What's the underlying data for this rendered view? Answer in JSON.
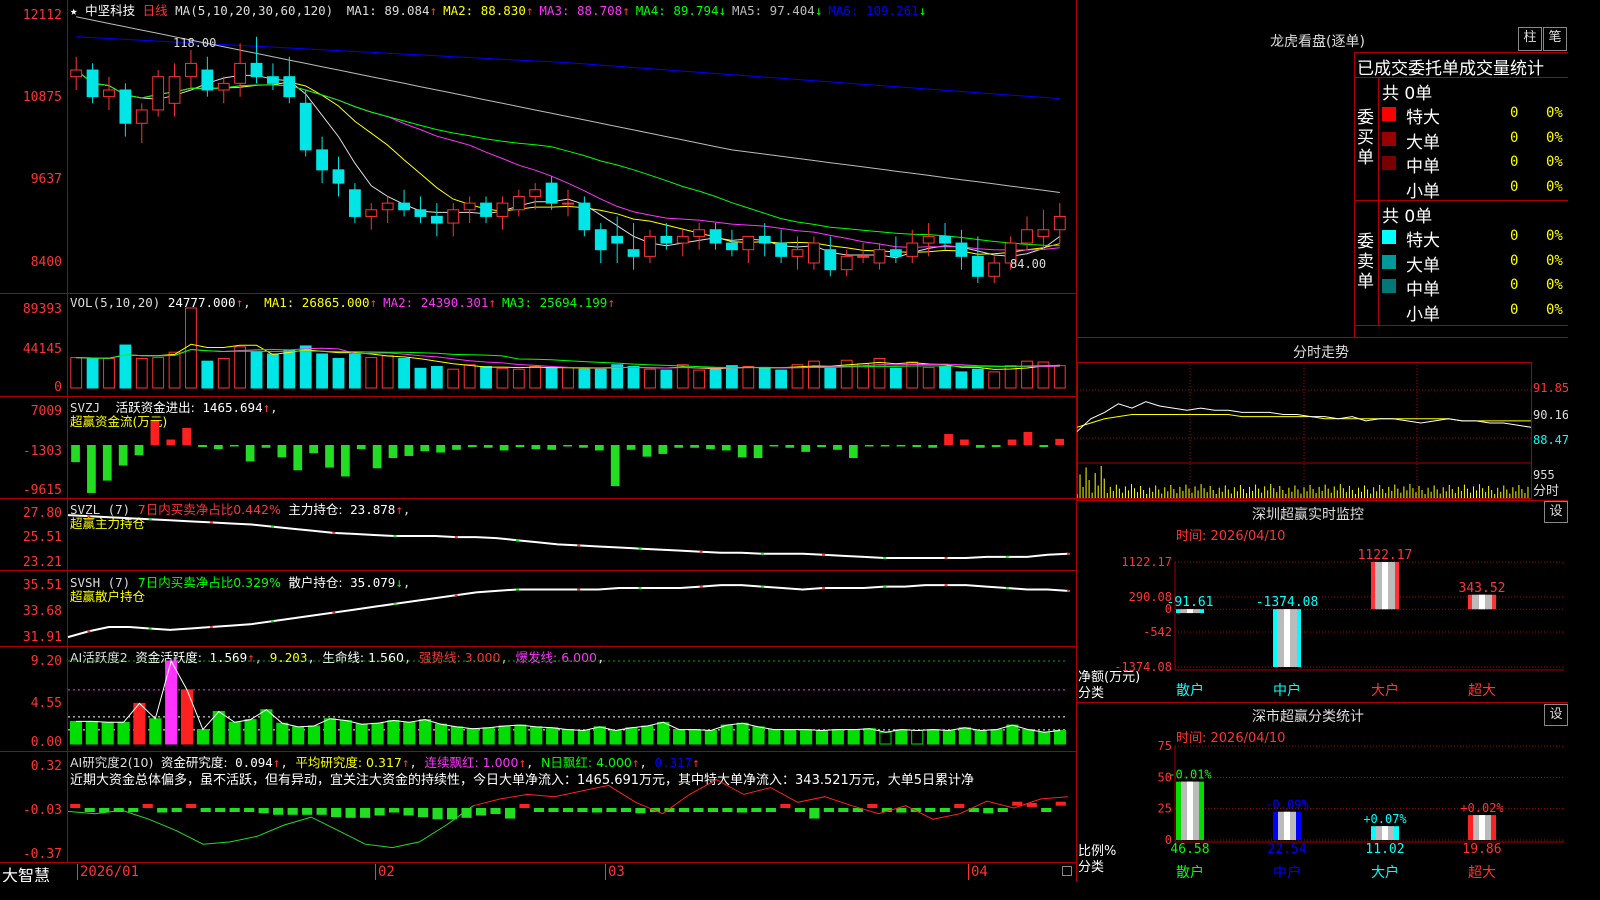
{
  "stock": {
    "star": "★",
    "name": "中坚科技",
    "period": "日线"
  },
  "colors": {
    "up": "#ff3333",
    "down": "#00e5e5",
    "ma1": "#dddddd",
    "ma2": "#ffff00",
    "ma3": "#ff33ff",
    "ma4": "#00ff00",
    "ma5": "#bbbbbb",
    "ma6": "#0000ff",
    "green": "#00dd00",
    "panel_border": "#aa0000"
  },
  "price_panel": {
    "header": "MA(5,10,20,30,60,120)",
    "ma_values": [
      {
        "label": "MA1: 89.084",
        "arrow": "↑",
        "color": "#dddddd"
      },
      {
        "label": "MA2: 88.830",
        "arrow": "↑",
        "color": "#ffff00"
      },
      {
        "label": "MA3: 88.708",
        "arrow": "↑",
        "color": "#ff33ff"
      },
      {
        "label": "MA4: 89.794",
        "arrow": "↓",
        "color": "#00ff00"
      },
      {
        "label": "MA5: 97.404",
        "arrow": "↓",
        "color": "#bbbbbb"
      },
      {
        "label": "MA6: 109.261",
        "arrow": "↓",
        "color": "#0000ff"
      }
    ],
    "axis": [
      "12112",
      "10875",
      "9637",
      "8400"
    ],
    "high_marker": "118.00",
    "low_marker": "84.00",
    "candles": [
      [
        112,
        115,
        110,
        113
      ],
      [
        113,
        114,
        108,
        109
      ],
      [
        109,
        112,
        107,
        110
      ],
      [
        110,
        111,
        103,
        105
      ],
      [
        105,
        108,
        102,
        107
      ],
      [
        107,
        113,
        106,
        112
      ],
      [
        108,
        114,
        106,
        112
      ],
      [
        112,
        116,
        110,
        114
      ],
      [
        113,
        115,
        109,
        110
      ],
      [
        110,
        112,
        108,
        111
      ],
      [
        111,
        117,
        109,
        114
      ],
      [
        114,
        118,
        111,
        112
      ],
      [
        112,
        114,
        110,
        111
      ],
      [
        112,
        115,
        108,
        109
      ],
      [
        108,
        110,
        100,
        101
      ],
      [
        101,
        103,
        96,
        98
      ],
      [
        98,
        100,
        94,
        96
      ],
      [
        95,
        96,
        90,
        91
      ],
      [
        91,
        93,
        89,
        92
      ],
      [
        92,
        94,
        90,
        93
      ],
      [
        93,
        95,
        91,
        92
      ],
      [
        92,
        94,
        90,
        91
      ],
      [
        91,
        93,
        88,
        90
      ],
      [
        90,
        93,
        88,
        92
      ],
      [
        92,
        94,
        90,
        93
      ],
      [
        93,
        94,
        90,
        91
      ],
      [
        91,
        94,
        89,
        93
      ],
      [
        92,
        95,
        91,
        94
      ],
      [
        94,
        96,
        92,
        95
      ],
      [
        96,
        97,
        92,
        93
      ],
      [
        93,
        95,
        91,
        93
      ],
      [
        93,
        94,
        88,
        89
      ],
      [
        89,
        90,
        84,
        86
      ],
      [
        88,
        91,
        84,
        87
      ],
      [
        86,
        90,
        83,
        85
      ],
      [
        85,
        89,
        84,
        88
      ],
      [
        88,
        90,
        86,
        87
      ],
      [
        87,
        89,
        85,
        88
      ],
      [
        88,
        90,
        86,
        89
      ],
      [
        89,
        90,
        86,
        87
      ],
      [
        87,
        89,
        85,
        86
      ],
      [
        86,
        88,
        84,
        88
      ],
      [
        88,
        90,
        85,
        87
      ],
      [
        87,
        89,
        84,
        85
      ],
      [
        85,
        88,
        83,
        86
      ],
      [
        84,
        88,
        83,
        87
      ],
      [
        86,
        88,
        82,
        83
      ],
      [
        83,
        86,
        82,
        85
      ],
      [
        85,
        87,
        84,
        85
      ],
      [
        84,
        87,
        83,
        86
      ],
      [
        86,
        88,
        84,
        85
      ],
      [
        85,
        89,
        84,
        87
      ],
      [
        87,
        90,
        85,
        88
      ],
      [
        88,
        90,
        86,
        87
      ],
      [
        87,
        89,
        83,
        85
      ],
      [
        85,
        88,
        81,
        82
      ],
      [
        82,
        85,
        81,
        84
      ],
      [
        84,
        88,
        83,
        87
      ],
      [
        87,
        91,
        86,
        89
      ],
      [
        88,
        92,
        86,
        89
      ],
      [
        89,
        93,
        87,
        91
      ]
    ]
  },
  "vol_panel": {
    "header": "VOL(5,10,20)",
    "value": "24777.000",
    "arrow": "↑",
    "ma_values": [
      {
        "label": "MA1: 26865.000",
        "arrow": "↑",
        "color": "#ffff00"
      },
      {
        "label": "MA2: 24390.301",
        "arrow": "↑",
        "color": "#ff33ff"
      },
      {
        "label": "MA3: 25694.199",
        "arrow": "↑",
        "color": "#00ff00"
      }
    ],
    "axis": [
      "89393",
      "44145",
      "0"
    ],
    "values": [
      34000,
      33000,
      33000,
      48000,
      33000,
      34000,
      40000,
      89393,
      30000,
      33000,
      46000,
      40000,
      38000,
      42000,
      47000,
      38000,
      33000,
      38000,
      34000,
      36000,
      33000,
      22000,
      24000,
      21000,
      26000,
      24000,
      22000,
      21000,
      24000,
      23000,
      23000,
      21000,
      21000,
      26000,
      24000,
      21000,
      20000,
      26000,
      20000,
      21000,
      25000,
      24000,
      23000,
      20000,
      26000,
      30000,
      22000,
      31000,
      27000,
      33000,
      22000,
      29000,
      23000,
      24000,
      18000,
      21000,
      18000,
      25000,
      30000,
      29000,
      25000
    ]
  },
  "svzj_panel": {
    "header": "SVZJ",
    "label": "活跃资金进出:",
    "value": "1465.694",
    "arrow": "↑",
    "subtitle": "超赢资金流(万元)",
    "axis": [
      "7009",
      "-1303",
      "-9615"
    ],
    "values": [
      -2500,
      -7000,
      -5200,
      -3000,
      -1500,
      3500,
      800,
      2500,
      -300,
      -600,
      -200,
      -2400,
      -400,
      -1800,
      -3700,
      -1200,
      -3300,
      -4600,
      -600,
      -3400,
      -1900,
      -1600,
      -900,
      -1100,
      -700,
      -300,
      -400,
      -800,
      -300,
      -600,
      -700,
      -200,
      -400,
      -800,
      -6000,
      -700,
      -1700,
      -1300,
      -400,
      -400,
      -600,
      -800,
      -1800,
      -1900,
      -200,
      -400,
      -1000,
      -300,
      -700,
      -1900,
      -200,
      -200,
      -200,
      -300,
      -400,
      1600,
      800,
      -400,
      -300,
      800,
      1900,
      -300,
      900
    ]
  },
  "svzl_panel": {
    "header": "SVZL (7)",
    "net": "7日内买卖净占比0.442%",
    "label": "主力持仓:",
    "value": "23.878",
    "arrow": "↑",
    "subtitle": "超赢主力持仓",
    "axis": [
      "27.80",
      "25.51",
      "23.21"
    ],
    "values": [
      27.6,
      27.5,
      27.4,
      27.3,
      27.2,
      27.1,
      27.0,
      26.9,
      26.8,
      26.7,
      26.5,
      26.3,
      26.1,
      25.9,
      25.8,
      25.7,
      25.6,
      25.6,
      25.6,
      25.5,
      25.5,
      25.4,
      25.2,
      25.0,
      24.8,
      24.7,
      24.6,
      24.5,
      24.4,
      24.3,
      24.2,
      24.1,
      24.0,
      24.0,
      23.9,
      23.9,
      23.9,
      23.8,
      23.7,
      23.6,
      23.5,
      23.5,
      23.5,
      23.5,
      23.5,
      23.6,
      23.6,
      23.6,
      23.8,
      23.9
    ]
  },
  "svsh_panel": {
    "header": "SVSH (7)",
    "net": "7日内买卖净占比0.329%",
    "label": "散户持仓:",
    "value": "35.079",
    "arrow": "↓",
    "subtitle": "超赢散户持仓",
    "axis": [
      "35.51",
      "33.68",
      "31.91"
    ],
    "values": [
      31.9,
      32.3,
      32.6,
      32.6,
      32.5,
      32.4,
      32.5,
      32.6,
      32.7,
      32.8,
      33.0,
      33.2,
      33.4,
      33.6,
      33.8,
      34.0,
      34.2,
      34.4,
      34.6,
      34.8,
      35.0,
      35.1,
      35.2,
      35.2,
      35.2,
      35.2,
      35.2,
      35.3,
      35.3,
      35.3,
      35.3,
      35.4,
      35.5,
      35.5,
      35.4,
      35.3,
      35.2,
      35.3,
      35.3,
      35.3,
      35.4,
      35.4,
      35.5,
      35.5,
      35.5,
      35.4,
      35.3,
      35.2,
      35.2,
      35.1
    ]
  },
  "ai1_panel": {
    "header": "AI活跃度2",
    "label": "资金活跃度:",
    "value": "1.569",
    "arrow": "↑",
    "v2": "9.203",
    "life": "生命线: 1.560",
    "strong": "强势线: 3.000",
    "burst": "爆发线: 6.000",
    "axis": [
      "9.20",
      "4.55",
      "0.00"
    ],
    "values": [
      2.5,
      2.5,
      2.4,
      2.4,
      4.5,
      2.8,
      9.2,
      6.0,
      1.6,
      3.6,
      2.4,
      2.7,
      3.8,
      2.3,
      1.9,
      2.0,
      2.8,
      2.6,
      2.2,
      2.3,
      2.6,
      2.4,
      2.7,
      2.2,
      1.9,
      1.7,
      1.8,
      2.0,
      2.1,
      1.9,
      1.8,
      1.6,
      1.5,
      1.9,
      1.5,
      1.8,
      2.0,
      2.4,
      1.6,
      1.6,
      1.5,
      2.1,
      2.3,
      1.9,
      1.6,
      1.6,
      1.6,
      1.5,
      1.6,
      1.6,
      1.7,
      1.3,
      1.6,
      1.5,
      1.6,
      1.5,
      1.8,
      1.5,
      1.6,
      2.1,
      1.6,
      1.3,
      1.5
    ]
  },
  "ai2_panel": {
    "header": "AI研究度2(10)",
    "label": "资金研究度:",
    "value": "0.094",
    "avg": "平均研究度: 0.317",
    "streak": "连续飘红: 1.000",
    "nday": "N日飘红: 4.000",
    "extra": "0.317",
    "axis": [
      "0.32",
      "-0.03",
      "-0.37"
    ],
    "comment": "近期大资金总体偏多，虽不活跃，但有异动，宜关注大资金的持续性，今日大单净流入：1465.691万元，其中特大单净流入：343.521万元，大单5日累计净",
    "values": [
      0.0,
      -0.05,
      -0.06,
      -0.03,
      -0.05,
      0.02,
      -0.06,
      -0.03,
      0.01,
      -0.01,
      -0.02,
      -0.03,
      -0.03,
      -0.07,
      -0.09,
      -0.09,
      -0.09,
      -0.09,
      -0.12,
      -0.13,
      -0.13,
      -0.1,
      -0.06,
      -0.1,
      -0.12,
      -0.15,
      -0.15,
      -0.13,
      -0.1,
      -0.08,
      -0.14,
      0.01,
      -0.01,
      -0.01,
      -0.03,
      -0.05,
      -0.06,
      -0.05,
      -0.04,
      -0.07,
      -0.05,
      -0.05,
      -0.03,
      -0.04,
      -0.02,
      -0.04,
      -0.06,
      -0.05,
      -0.03,
      0.02,
      -0.02,
      -0.14,
      -0.03,
      -0.03,
      -0.02,
      0.02,
      -0.04,
      -0.06,
      -0.05,
      -0.02,
      -0.04,
      0.03,
      -0.05,
      -0.07,
      -0.04,
      0.05,
      0.04,
      -0.02,
      0.05
    ],
    "line": [
      -0.03,
      -0.05,
      -0.02,
      -0.1,
      -0.2,
      -0.32,
      -0.3,
      -0.25,
      -0.15,
      -0.08,
      -0.2,
      -0.32,
      -0.35,
      -0.3,
      -0.15,
      0.02,
      0.08,
      0.12,
      0.1,
      0.15,
      0.2,
      0.05,
      -0.05,
      0.12,
      0.25,
      0.12,
      0.18,
      0.05,
      0.1,
      0.02,
      -0.05,
      0.02,
      -0.1,
      -0.05,
      0.06,
      0.0,
      0.08,
      0.1
    ]
  },
  "date_axis": [
    "2026/01",
    "02",
    "03",
    "04"
  ],
  "brand": "大智慧",
  "longhu": {
    "title": "龙虎看盘(逐单)",
    "btn1": "柱",
    "btn2": "笔",
    "header": "已成交委托单成交量统计",
    "buy_title": "委买单",
    "sell_title": "委卖单",
    "buy_total": "共 0单",
    "sell_total": "共 0单",
    "buy_rows": [
      {
        "name": "特大",
        "qty": "0",
        "pct": "0%",
        "color": "#ff0000"
      },
      {
        "name": "大单",
        "qty": "0",
        "pct": "0%",
        "color": "#990000"
      },
      {
        "name": "中单",
        "qty": "0",
        "pct": "0%",
        "color": "#770000"
      },
      {
        "name": "小单",
        "qty": "0",
        "pct": "0%",
        "color": ""
      }
    ],
    "sell_rows": [
      {
        "name": "特大",
        "qty": "0",
        "pct": "0%",
        "color": "#00ffff"
      },
      {
        "name": "大单",
        "qty": "0",
        "pct": "0%",
        "color": "#009999"
      },
      {
        "name": "中单",
        "qty": "0",
        "pct": "0%",
        "color": "#007777"
      },
      {
        "name": "小单",
        "qty": "0",
        "pct": "0%",
        "color": ""
      }
    ]
  },
  "fenshi": {
    "title": "分时走势",
    "axis": [
      "91.85",
      "90.16",
      "88.47",
      "955"
    ],
    "unit": "分时",
    "values": [
      89.9,
      90.5,
      90.8,
      91.2,
      91.0,
      91.3,
      91.1,
      91.0,
      90.9,
      91.0,
      90.9,
      90.9,
      90.8,
      90.8,
      90.8,
      90.7,
      90.7,
      90.6,
      90.6,
      90.5,
      90.6,
      90.4,
      90.5,
      90.5,
      90.4,
      90.3,
      90.4,
      90.5,
      90.4,
      90.4,
      90.3,
      90.3,
      90.2,
      90.1
    ],
    "avg": [
      90.1,
      90.3,
      90.5,
      90.6,
      90.7,
      90.7,
      90.7,
      90.7,
      90.7,
      90.7,
      90.7,
      90.7,
      90.6,
      90.6,
      90.6,
      90.6,
      90.6,
      90.6,
      90.5,
      90.5,
      90.5,
      90.5,
      90.5,
      90.5,
      90.5,
      90.5,
      90.5,
      90.5,
      90.4,
      90.4,
      90.4,
      90.4,
      90.4,
      90.4
    ]
  },
  "sz_monitor": {
    "title": "深圳超赢实时监控",
    "btn": "设",
    "time": "时间: 2026/04/10",
    "axis": [
      "1122.17",
      "290.08",
      "0",
      "-542",
      "-1374.08"
    ],
    "ylabel": "净额(万元)",
    "xlabel": "分类",
    "categories": [
      "散户",
      "中户",
      "大户",
      "超大"
    ],
    "values": [
      -91.61,
      -1374.08,
      1122.17,
      343.52
    ],
    "labels": [
      "-91.61",
      "-1374.08",
      "1122.17",
      "343.52"
    ]
  },
  "sz_class": {
    "title": "深市超赢分类统计",
    "btn": "设",
    "time": "时间: 2026/04/10",
    "axis": [
      "75",
      "50",
      "25",
      "0"
    ],
    "ylabel": "比例%",
    "xlabel": "分类",
    "categories": [
      "散户",
      "中户",
      "大户",
      "超大"
    ],
    "values": [
      46.58,
      22.54,
      11.02,
      19.86
    ],
    "changes": [
      "-0.01%",
      "-0.09%",
      "+0.07%",
      "+0.02%"
    ]
  }
}
